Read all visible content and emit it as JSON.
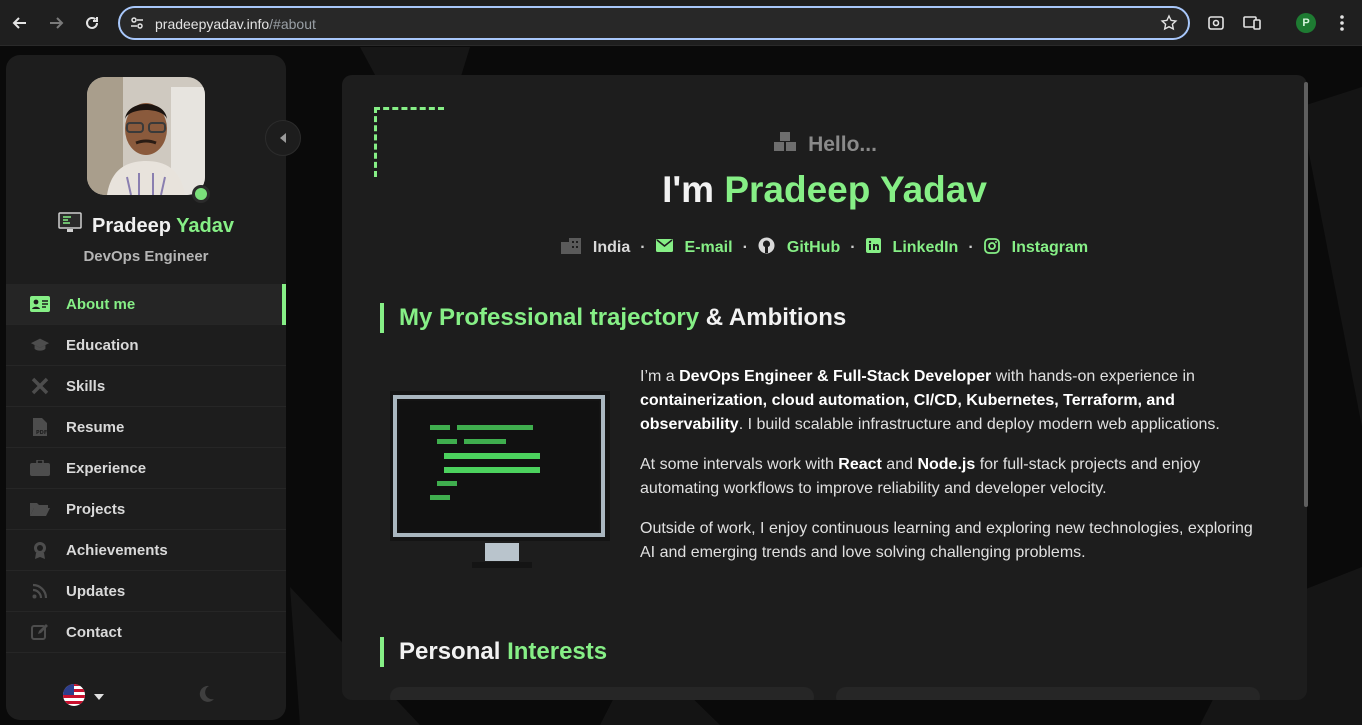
{
  "browser": {
    "url_host": "pradeepyadav.info",
    "url_path": "/#about",
    "profile_initial": "P"
  },
  "sidebar": {
    "name_first": "Pradeep",
    "name_last": "Yadav",
    "role": "DevOps Engineer",
    "items": [
      {
        "label": "About me",
        "icon": "id-card-icon",
        "active": true
      },
      {
        "label": "Education",
        "icon": "graduation-cap-icon"
      },
      {
        "label": "Skills",
        "icon": "tools-icon"
      },
      {
        "label": "Resume",
        "icon": "pdf-file-icon"
      },
      {
        "label": "Experience",
        "icon": "briefcase-icon"
      },
      {
        "label": "Projects",
        "icon": "folder-open-icon"
      },
      {
        "label": "Achievements",
        "icon": "award-icon"
      },
      {
        "label": "Updates",
        "icon": "rss-icon"
      },
      {
        "label": "Contact",
        "icon": "edit-icon"
      }
    ]
  },
  "hero": {
    "greeting": "Hello...",
    "headline_prefix": "I'm",
    "headline_name": "Pradeep Yadav",
    "links": [
      {
        "label": "India",
        "icon": "city-icon"
      },
      {
        "label": "E-mail",
        "icon": "envelope-icon"
      },
      {
        "label": "GitHub",
        "icon": "github-icon"
      },
      {
        "label": "LinkedIn",
        "icon": "linkedin-icon"
      },
      {
        "label": "Instagram",
        "icon": "instagram-icon"
      }
    ]
  },
  "about": {
    "title_highlight": "My Professional trajectory",
    "title_rest": "& Ambitions",
    "p1_a": "I’m a ",
    "p1_b": "DevOps Engineer & Full-Stack Developer",
    "p1_c": " with hands-on experience in ",
    "p1_d": "containerization, cloud automation, CI/CD, Kubernetes, Terraform, and observability",
    "p1_e": ". I build scalable infrastructure and deploy modern web applications.",
    "p2_a": "At some intervals work with ",
    "p2_b": "React",
    "p2_c": " and ",
    "p2_d": "Node.js",
    "p2_e": " for full-stack projects and enjoy automating workflows to improve reliability and developer velocity.",
    "p3": "Outside of work, I enjoy continuous learning and exploring new technologies, exploring AI and emerging trends and love solving challenging problems."
  },
  "interests": {
    "title_plain": "Personal",
    "title_highlight": "Interests"
  },
  "colors": {
    "accent": "#86ef86",
    "panel": "#1d1d1d",
    "background": "#0a0a0a"
  }
}
